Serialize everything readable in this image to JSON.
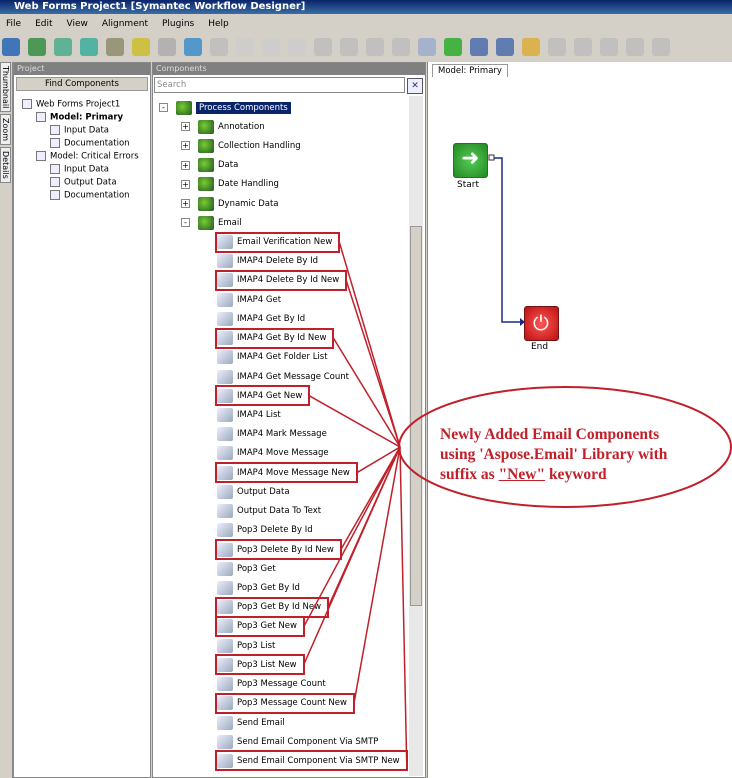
{
  "title": "Web Forms Project1 [Symantec Workflow Designer]",
  "menu": [
    "File",
    "Edit",
    "View",
    "Alignment",
    "Plugins",
    "Help"
  ],
  "side_tabs": [
    "Thumbnail",
    "Zoom",
    "Details"
  ],
  "project": {
    "header": "Project",
    "find_button": "Find Components",
    "tree": [
      {
        "label": "Web Forms Project1",
        "indent": 0
      },
      {
        "label": "Model: Primary",
        "indent": 1,
        "bold": true
      },
      {
        "label": "Input Data",
        "indent": 2
      },
      {
        "label": "Documentation",
        "indent": 2
      },
      {
        "label": "Model: Critical Errors",
        "indent": 1
      },
      {
        "label": "Input Data",
        "indent": 2
      },
      {
        "label": "Output Data",
        "indent": 2
      },
      {
        "label": "Documentation",
        "indent": 2
      }
    ]
  },
  "components": {
    "header": "Components",
    "search_placeholder": "Search",
    "root": "Process Components",
    "groups": [
      "Annotation",
      "Collection Handling",
      "Data",
      "Date Handling",
      "Dynamic Data",
      "Email"
    ],
    "email_items": [
      {
        "label": "Email Verification New",
        "new": true
      },
      {
        "label": "IMAP4 Delete By Id"
      },
      {
        "label": "IMAP4 Delete By Id New",
        "new": true
      },
      {
        "label": "IMAP4 Get"
      },
      {
        "label": "IMAP4 Get By Id"
      },
      {
        "label": "IMAP4 Get By Id New",
        "new": true
      },
      {
        "label": "IMAP4 Get Folder List"
      },
      {
        "label": "IMAP4 Get Message Count"
      },
      {
        "label": "IMAP4 Get New",
        "new": true
      },
      {
        "label": "IMAP4 List"
      },
      {
        "label": "IMAP4 Mark Message"
      },
      {
        "label": "IMAP4 Move Message"
      },
      {
        "label": "IMAP4 Move Message New",
        "new": true
      },
      {
        "label": "Output Data"
      },
      {
        "label": "Output Data To Text"
      },
      {
        "label": "Pop3 Delete By Id"
      },
      {
        "label": "Pop3 Delete By Id New",
        "new": true
      },
      {
        "label": "Pop3 Get"
      },
      {
        "label": "Pop3 Get By Id"
      },
      {
        "label": "Pop3 Get By Id New",
        "new": true
      },
      {
        "label": "Pop3 Get New",
        "new": true
      },
      {
        "label": "Pop3 List"
      },
      {
        "label": "Pop3 List New",
        "new": true
      },
      {
        "label": "Pop3 Message Count"
      },
      {
        "label": "Pop3 Message Count New",
        "new": true
      },
      {
        "label": "Send Email"
      },
      {
        "label": "Send Email Component Via SMTP"
      },
      {
        "label": "Send Email Component Via SMTP New",
        "new": true
      }
    ]
  },
  "design": {
    "tab": "Model: Primary",
    "start_label": "Start",
    "end_label": "End"
  },
  "callout": {
    "line1": "Newly Added Email Components",
    "line2": "using 'Aspose.Email' Library with",
    "line3_prefix": "suffix as ",
    "line3_keyword": "\"New\"",
    "line3_suffix": " keyword"
  },
  "colors": {
    "annotation": "#c0202a",
    "title_bar": "#0a246a",
    "selection": "#0a246a"
  }
}
